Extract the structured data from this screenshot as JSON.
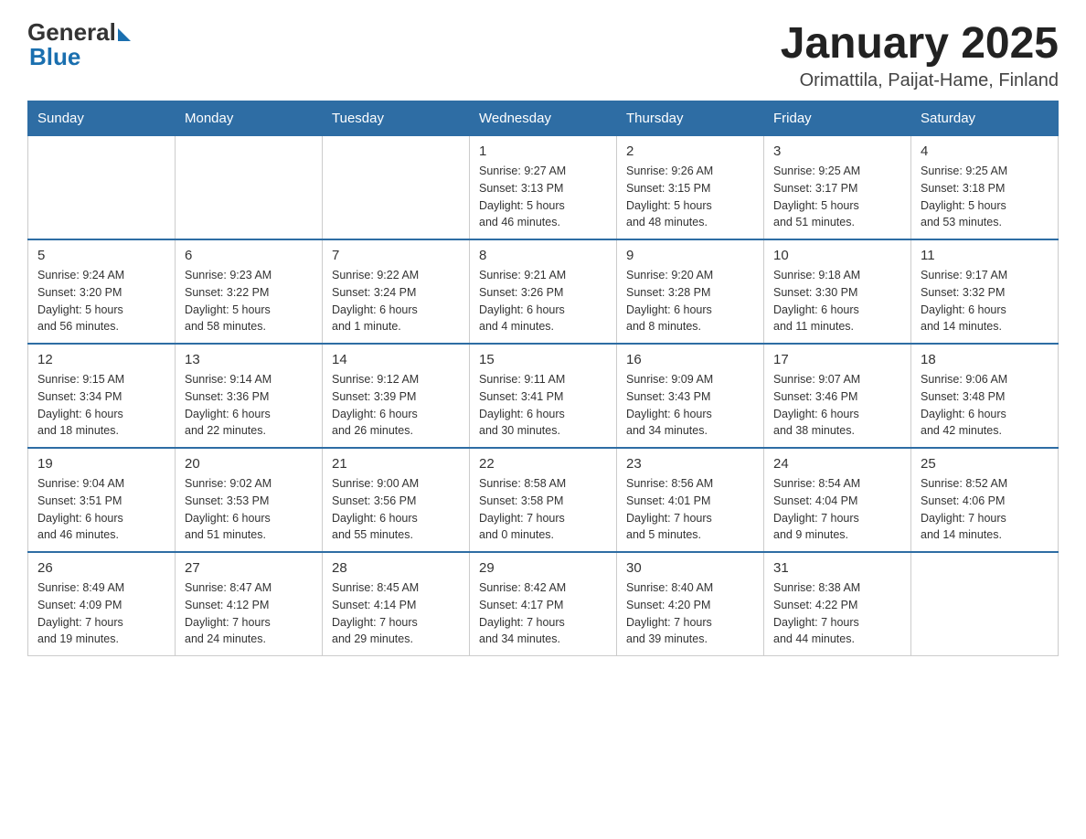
{
  "header": {
    "logo": {
      "general": "General",
      "blue": "Blue"
    },
    "title": "January 2025",
    "location": "Orimattila, Paijat-Hame, Finland"
  },
  "days_of_week": [
    "Sunday",
    "Monday",
    "Tuesday",
    "Wednesday",
    "Thursday",
    "Friday",
    "Saturday"
  ],
  "weeks": [
    [
      {
        "day": "",
        "info": ""
      },
      {
        "day": "",
        "info": ""
      },
      {
        "day": "",
        "info": ""
      },
      {
        "day": "1",
        "info": "Sunrise: 9:27 AM\nSunset: 3:13 PM\nDaylight: 5 hours\nand 46 minutes."
      },
      {
        "day": "2",
        "info": "Sunrise: 9:26 AM\nSunset: 3:15 PM\nDaylight: 5 hours\nand 48 minutes."
      },
      {
        "day": "3",
        "info": "Sunrise: 9:25 AM\nSunset: 3:17 PM\nDaylight: 5 hours\nand 51 minutes."
      },
      {
        "day": "4",
        "info": "Sunrise: 9:25 AM\nSunset: 3:18 PM\nDaylight: 5 hours\nand 53 minutes."
      }
    ],
    [
      {
        "day": "5",
        "info": "Sunrise: 9:24 AM\nSunset: 3:20 PM\nDaylight: 5 hours\nand 56 minutes."
      },
      {
        "day": "6",
        "info": "Sunrise: 9:23 AM\nSunset: 3:22 PM\nDaylight: 5 hours\nand 58 minutes."
      },
      {
        "day": "7",
        "info": "Sunrise: 9:22 AM\nSunset: 3:24 PM\nDaylight: 6 hours\nand 1 minute."
      },
      {
        "day": "8",
        "info": "Sunrise: 9:21 AM\nSunset: 3:26 PM\nDaylight: 6 hours\nand 4 minutes."
      },
      {
        "day": "9",
        "info": "Sunrise: 9:20 AM\nSunset: 3:28 PM\nDaylight: 6 hours\nand 8 minutes."
      },
      {
        "day": "10",
        "info": "Sunrise: 9:18 AM\nSunset: 3:30 PM\nDaylight: 6 hours\nand 11 minutes."
      },
      {
        "day": "11",
        "info": "Sunrise: 9:17 AM\nSunset: 3:32 PM\nDaylight: 6 hours\nand 14 minutes."
      }
    ],
    [
      {
        "day": "12",
        "info": "Sunrise: 9:15 AM\nSunset: 3:34 PM\nDaylight: 6 hours\nand 18 minutes."
      },
      {
        "day": "13",
        "info": "Sunrise: 9:14 AM\nSunset: 3:36 PM\nDaylight: 6 hours\nand 22 minutes."
      },
      {
        "day": "14",
        "info": "Sunrise: 9:12 AM\nSunset: 3:39 PM\nDaylight: 6 hours\nand 26 minutes."
      },
      {
        "day": "15",
        "info": "Sunrise: 9:11 AM\nSunset: 3:41 PM\nDaylight: 6 hours\nand 30 minutes."
      },
      {
        "day": "16",
        "info": "Sunrise: 9:09 AM\nSunset: 3:43 PM\nDaylight: 6 hours\nand 34 minutes."
      },
      {
        "day": "17",
        "info": "Sunrise: 9:07 AM\nSunset: 3:46 PM\nDaylight: 6 hours\nand 38 minutes."
      },
      {
        "day": "18",
        "info": "Sunrise: 9:06 AM\nSunset: 3:48 PM\nDaylight: 6 hours\nand 42 minutes."
      }
    ],
    [
      {
        "day": "19",
        "info": "Sunrise: 9:04 AM\nSunset: 3:51 PM\nDaylight: 6 hours\nand 46 minutes."
      },
      {
        "day": "20",
        "info": "Sunrise: 9:02 AM\nSunset: 3:53 PM\nDaylight: 6 hours\nand 51 minutes."
      },
      {
        "day": "21",
        "info": "Sunrise: 9:00 AM\nSunset: 3:56 PM\nDaylight: 6 hours\nand 55 minutes."
      },
      {
        "day": "22",
        "info": "Sunrise: 8:58 AM\nSunset: 3:58 PM\nDaylight: 7 hours\nand 0 minutes."
      },
      {
        "day": "23",
        "info": "Sunrise: 8:56 AM\nSunset: 4:01 PM\nDaylight: 7 hours\nand 5 minutes."
      },
      {
        "day": "24",
        "info": "Sunrise: 8:54 AM\nSunset: 4:04 PM\nDaylight: 7 hours\nand 9 minutes."
      },
      {
        "day": "25",
        "info": "Sunrise: 8:52 AM\nSunset: 4:06 PM\nDaylight: 7 hours\nand 14 minutes."
      }
    ],
    [
      {
        "day": "26",
        "info": "Sunrise: 8:49 AM\nSunset: 4:09 PM\nDaylight: 7 hours\nand 19 minutes."
      },
      {
        "day": "27",
        "info": "Sunrise: 8:47 AM\nSunset: 4:12 PM\nDaylight: 7 hours\nand 24 minutes."
      },
      {
        "day": "28",
        "info": "Sunrise: 8:45 AM\nSunset: 4:14 PM\nDaylight: 7 hours\nand 29 minutes."
      },
      {
        "day": "29",
        "info": "Sunrise: 8:42 AM\nSunset: 4:17 PM\nDaylight: 7 hours\nand 34 minutes."
      },
      {
        "day": "30",
        "info": "Sunrise: 8:40 AM\nSunset: 4:20 PM\nDaylight: 7 hours\nand 39 minutes."
      },
      {
        "day": "31",
        "info": "Sunrise: 8:38 AM\nSunset: 4:22 PM\nDaylight: 7 hours\nand 44 minutes."
      },
      {
        "day": "",
        "info": ""
      }
    ]
  ]
}
